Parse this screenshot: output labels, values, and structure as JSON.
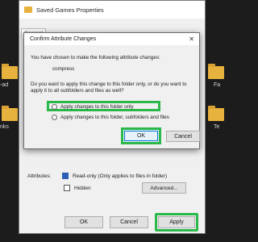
{
  "background": {
    "left_labels": [
      "-ad",
      "nks"
    ],
    "right_labels": [
      "Fa",
      "Te"
    ]
  },
  "props": {
    "title": "Saved Games Properties",
    "tab_label": "General",
    "attributes_label": "Attributes:",
    "readonly_label": "Read-only (Only applies to files in folder)",
    "hidden_label": "Hidden",
    "advanced_label": "Advanced...",
    "ok_label": "OK",
    "cancel_label": "Cancel",
    "apply_label": "Apply"
  },
  "dialog": {
    "title": "Confirm Attribute Changes",
    "intro": "You have chosen to make the following attribute changes:",
    "change": "compress",
    "question_line1": "Do you want to apply this change to this folder only, or do you want to",
    "question_line2": "apply it to all subfolders and files as well?",
    "option1": "Apply changes to this folder only",
    "option2": "Apply changes to this folder, subfolders and files",
    "ok_label": "OK",
    "cancel_label": "Cancel"
  },
  "colors": {
    "highlight": "#2bb84a",
    "accent": "#0078d4"
  }
}
